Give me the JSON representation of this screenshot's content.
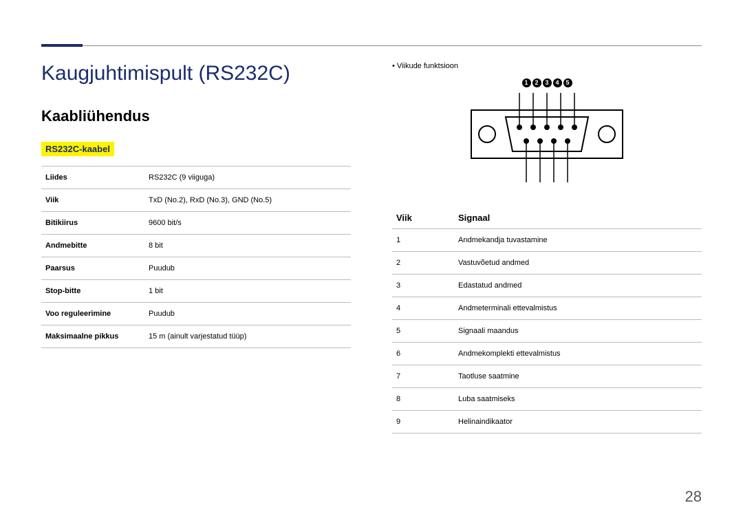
{
  "title": "Kaugjuhtimispult (RS232C)",
  "section": "Kaabliühendus",
  "subsection": "RS232C-kaabel",
  "spec_table": {
    "rows": [
      {
        "label": "Liides",
        "value": "RS232C (9 viiguga)"
      },
      {
        "label": "Viik",
        "value": "TxD (No.2), RxD (No.3), GND (No.5)"
      },
      {
        "label": "Bitikiirus",
        "value": "9600 bit/s"
      },
      {
        "label": "Andmebitte",
        "value": "8 bit"
      },
      {
        "label": "Paarsus",
        "value": "Puudub"
      },
      {
        "label": "Stop-bitte",
        "value": "1 bit"
      },
      {
        "label": "Voo reguleerimine",
        "value": "Puudub"
      },
      {
        "label": "Maksimaalne pikkus",
        "value": "15 m (ainult varjestatud tüüp)"
      }
    ]
  },
  "pin_bullet": "Viikude funktsioon",
  "pin_badges": [
    "1",
    "2",
    "3",
    "4",
    "5"
  ],
  "signal_table": {
    "headers": {
      "pin": "Viik",
      "signal": "Signaal"
    },
    "rows": [
      {
        "pin": "1",
        "signal": "Andmekandja tuvastamine"
      },
      {
        "pin": "2",
        "signal": "Vastuvõetud andmed"
      },
      {
        "pin": "3",
        "signal": "Edastatud andmed"
      },
      {
        "pin": "4",
        "signal": "Andmeterminali ettevalmistus"
      },
      {
        "pin": "5",
        "signal": "Signaali maandus"
      },
      {
        "pin": "6",
        "signal": "Andmekomplekti ettevalmistus"
      },
      {
        "pin": "7",
        "signal": "Taotluse saatmine"
      },
      {
        "pin": "8",
        "signal": "Luba saatmiseks"
      },
      {
        "pin": "9",
        "signal": "Helinaindikaator"
      }
    ]
  },
  "page_number": "28"
}
